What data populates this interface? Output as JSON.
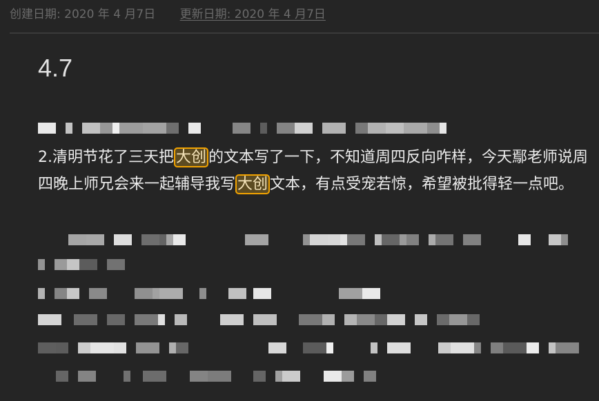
{
  "meta": {
    "created": "创建日期: 2020 年 4 月7日",
    "updated": "更新日期: 2020 年 4 月7日"
  },
  "note": {
    "title": "4.7",
    "paragraph": {
      "part1": "2.清明节花了三天把",
      "highlight1": "大创",
      "part2": "的文本写了一下，不知道周四反向咋样，今天鄢老师说周四晚上师兄会来一起辅导我写",
      "highlight2": "大创",
      "part3": "文本，有点受宠若惊，希望被批得轻一点吧。"
    }
  },
  "colors": {
    "highlight_border": "#f2a300",
    "highlight_bg": "#5c4b22",
    "background": "#252525"
  }
}
